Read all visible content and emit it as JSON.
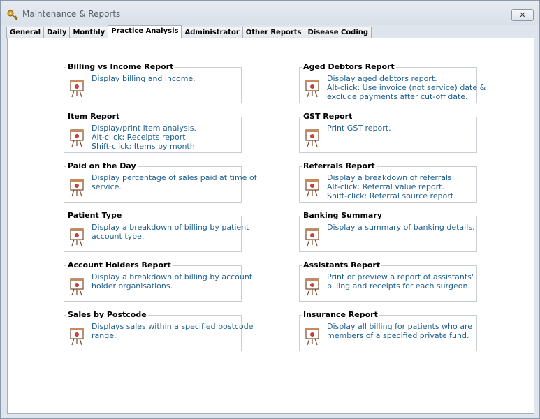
{
  "window": {
    "title": "Maintenance & Reports",
    "close_label": "✕"
  },
  "tabs": [
    {
      "label": "General"
    },
    {
      "label": "Daily"
    },
    {
      "label": "Monthly"
    },
    {
      "label": "Practice Analysis",
      "active": true
    },
    {
      "label": "Administrator"
    },
    {
      "label": "Other Reports"
    },
    {
      "label": "Disease Coding"
    }
  ],
  "reports": {
    "billing_vs_income": {
      "title": "Billing vs Income Report",
      "lines": [
        "Display billing and income."
      ]
    },
    "item": {
      "title": "Item Report",
      "lines": [
        "Display/print item analysis.",
        "Alt-click: Receipts report",
        "Shift-click: Items by month"
      ]
    },
    "paid_on_day": {
      "title": "Paid on the Day",
      "lines": [
        "Display percentage of sales paid at time of",
        "service."
      ]
    },
    "patient_type": {
      "title": "Patient Type",
      "lines": [
        "Display a breakdown of billing by patient",
        "account type."
      ]
    },
    "account_holders": {
      "title": "Account Holders Report",
      "lines": [
        "Display a breakdown of billing by account",
        "holder organisations."
      ]
    },
    "sales_postcode": {
      "title": "Sales by Postcode",
      "lines": [
        "Displays sales within a specified postcode",
        "range."
      ]
    },
    "aged_debtors": {
      "title": "Aged Debtors Report",
      "lines": [
        "Display aged debtors report.",
        "Alt-click: Use invoice (not service) date &",
        "exclude payments after cut-off date."
      ]
    },
    "gst": {
      "title": "GST Report",
      "lines": [
        "Print GST report."
      ]
    },
    "referrals": {
      "title": "Referrals Report",
      "lines": [
        "Display a breakdown of referrals.",
        "Alt-click: Referral value report.",
        "Shift-click: Referral source report."
      ]
    },
    "banking_summary": {
      "title": "Banking Summary",
      "lines": [
        "Display a summary of banking details."
      ]
    },
    "assistants": {
      "title": "Assistants Report",
      "lines": [
        "Print or preview a report of assistants'",
        "billing and receipts for each surgeon."
      ]
    },
    "insurance": {
      "title": "Insurance Report",
      "lines": [
        "Display all billing for patients who are",
        "members of a specified private fund."
      ]
    }
  },
  "colors": {
    "description_text": "#1f5f8f",
    "window_frame": "#dfe5ec",
    "panel": "#ffffff"
  },
  "icons": {
    "report": "presentation-board-icon",
    "app": "app-key-icon"
  }
}
